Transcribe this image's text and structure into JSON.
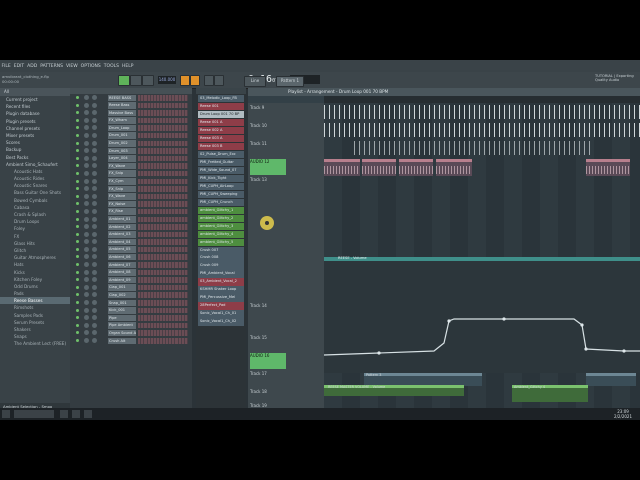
{
  "menu": [
    "FILE",
    "EDIT",
    "ADD",
    "PATTERNS",
    "VIEW",
    "OPTIONS",
    "TOOLS",
    "HELP"
  ],
  "transport": {
    "bpm": "140.000",
    "time": "0:16",
    "time_ms": "07",
    "pattern": "Pattern 1",
    "snap": "Line"
  },
  "hint": {
    "line1": "amvibrant_clothing_e.flp",
    "line2": "00:00:00"
  },
  "news": {
    "line1": "TUTORIAL | Exporting",
    "line2": "Quality Audio"
  },
  "browser": {
    "title": "All",
    "items": [
      {
        "label": "Current project",
        "sub": false
      },
      {
        "label": "Recent files",
        "sub": false
      },
      {
        "label": "Plugin database",
        "sub": false
      },
      {
        "label": "Plugin presets",
        "sub": false
      },
      {
        "label": "Channel presets",
        "sub": false
      },
      {
        "label": "Mixer presets",
        "sub": false
      },
      {
        "label": "Scores",
        "sub": false
      },
      {
        "label": "Backup",
        "sub": false
      },
      {
        "label": "Best Packs",
        "sub": false
      },
      {
        "label": "Ambient Simo_Schaufert",
        "sub": false
      },
      {
        "label": "Acoustic Hats",
        "sub": true
      },
      {
        "label": "Acoustic Rides",
        "sub": true
      },
      {
        "label": "Acoustic Snares",
        "sub": true
      },
      {
        "label": "Bass Guitar One Shots",
        "sub": true
      },
      {
        "label": "Bowed Cymbals",
        "sub": true
      },
      {
        "label": "Cabasa",
        "sub": true
      },
      {
        "label": "Crash & Splash",
        "sub": true
      },
      {
        "label": "Drum Loops",
        "sub": true
      },
      {
        "label": "Foley",
        "sub": true
      },
      {
        "label": "FX",
        "sub": true
      },
      {
        "label": "Glass Hits",
        "sub": true
      },
      {
        "label": "Glitch",
        "sub": true
      },
      {
        "label": "Guitar Atmospheres",
        "sub": true
      },
      {
        "label": "Hats",
        "sub": true
      },
      {
        "label": "Kicks",
        "sub": true
      },
      {
        "label": "Kitchen Foley",
        "sub": true
      },
      {
        "label": "Odd Drums",
        "sub": true
      },
      {
        "label": "Pads",
        "sub": true
      },
      {
        "label": "Reese Basses",
        "sub": true,
        "selected": true
      },
      {
        "label": "Rimshots",
        "sub": true
      },
      {
        "label": "Samples Pads",
        "sub": true
      },
      {
        "label": "Serum Presets",
        "sub": true
      },
      {
        "label": "Shakers",
        "sub": true
      },
      {
        "label": "Snaps",
        "sub": true
      },
      {
        "label": "The Ambient Lect (FREE)",
        "sub": true
      }
    ],
    "footer": "Ambient Selection - Smoo"
  },
  "rack": {
    "channels": [
      "REESE BASS",
      "Reese Bass",
      "Massive Bass",
      "FX_Wham",
      "Drum_Loop",
      "Drum_001",
      "Drum_002",
      "Drum_003",
      "Layer_004",
      "FX_Wave",
      "FX_Snip",
      "FX_Cym",
      "FX_Snip",
      "FX_Wave",
      "FX_Noise",
      "FX_Rise",
      "Ambient_01",
      "Ambient_02",
      "Ambient_03",
      "Ambient_04",
      "Ambient_05",
      "Ambient_06",
      "Ambient_07",
      "Ambient_08",
      "Ambient_09",
      "Clap_001",
      "Clap_002",
      "Snap_001",
      "Kick_001",
      "Pipe",
      "Pipe Ambient",
      "Organ Sound A",
      "Crush Alt"
    ],
    "steps_color": "#6b4d55"
  },
  "patterns": [
    {
      "label": "03_Melodic_Loop_FB",
      "c": "blue"
    },
    {
      "label": "Reese 001",
      "c": "red"
    },
    {
      "label": "Drum Loop 001 70 BP",
      "c": "sel"
    },
    {
      "label": "Reese 001 A",
      "c": "red"
    },
    {
      "label": "Reese 002 A",
      "c": "red"
    },
    {
      "label": "Reese 003 A",
      "c": "red"
    },
    {
      "label": "Reese 003 B",
      "c": "red"
    },
    {
      "label": "02_Pulse_Drum_Exc",
      "c": "blue"
    },
    {
      "label": "PMI_Fretted_Guitar",
      "c": "blue"
    },
    {
      "label": "PMI_Wide_Sound_07",
      "c": "blue"
    },
    {
      "label": "PMI_Kick_Tight",
      "c": "blue"
    },
    {
      "label": "PMI_CUPH_AirLoop",
      "c": "blue"
    },
    {
      "label": "PMI_CUPH_Sweeping",
      "c": "blue"
    },
    {
      "label": "PMI_CUPH_Crunch",
      "c": "blue"
    },
    {
      "label": "ambient_Glitchy_1",
      "c": "green"
    },
    {
      "label": "ambient_Glitchy_2",
      "c": "green"
    },
    {
      "label": "ambient_Glitchy_3",
      "c": "green"
    },
    {
      "label": "ambient_Glitchy_4",
      "c": "green"
    },
    {
      "label": "ambient_Glitchy_5",
      "c": "green"
    },
    {
      "label": "Crush 007",
      "c": "blue"
    },
    {
      "label": "Crush 008",
      "c": "blue"
    },
    {
      "label": "Crush 009",
      "c": "blue"
    },
    {
      "label": "PMI_Ambient_Vocal",
      "c": "blue"
    },
    {
      "label": "03_Ambient_Vocal_2",
      "c": "red"
    },
    {
      "label": "KSHMR Shaker Loop",
      "c": "blue"
    },
    {
      "label": "PMI_Percussive_Mel",
      "c": "blue"
    },
    {
      "label": "28Perfect_Pad",
      "c": "red"
    },
    {
      "label": "Sonic_Vocal1_Ch_01",
      "c": "blue"
    },
    {
      "label": "Sonic_Vocal1_Ch_02",
      "c": "blue"
    }
  ],
  "playlist": {
    "title": "Playlist - Arrangement - Drum Loop 001 70 BPM",
    "tracks": [
      "Track 9",
      "Track 10",
      "Track 11",
      "AUDIO 12",
      "Track 13",
      "Track 14",
      "Track 15",
      "AUDIO 16",
      "Track 17",
      "Track 18",
      "Track 19"
    ],
    "automation_label": "REESE - Volume",
    "pattern_label": "Pattern 3",
    "audio_clip_label": "Ambient_Glitchy 4",
    "volume_clip_label": "REESE MASTER VOLUME - Volume"
  },
  "taskbar": {
    "time": "23:09",
    "date": "2/2/2021"
  }
}
